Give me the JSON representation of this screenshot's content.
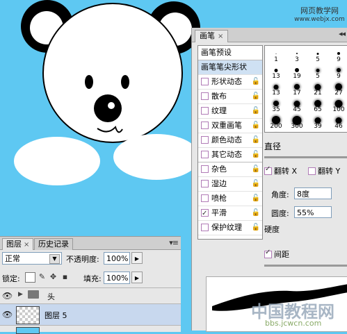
{
  "watermark_top": {
    "line1": "网页教学网",
    "line2": "www.webjx.com"
  },
  "watermark_bottom": {
    "line1": "中国教程网",
    "line2": "bbs.jcwcn.com"
  },
  "brush_panel": {
    "tab_label": "画笔",
    "tab_close": "×",
    "preset_label": "画笔预设",
    "items": [
      {
        "label": "画笔笔尖形状",
        "checked": false,
        "selected": true,
        "lock": false
      },
      {
        "label": "形状动态",
        "checked": false,
        "selected": false,
        "lock": true
      },
      {
        "label": "散布",
        "checked": false,
        "selected": false,
        "lock": true
      },
      {
        "label": "纹理",
        "checked": false,
        "selected": false,
        "lock": true
      },
      {
        "label": "双重画笔",
        "checked": false,
        "selected": false,
        "lock": true
      },
      {
        "label": "颜色动态",
        "checked": false,
        "selected": false,
        "lock": true
      },
      {
        "label": "其它动态",
        "checked": false,
        "selected": false,
        "lock": true
      },
      {
        "label": "杂色",
        "checked": false,
        "selected": false,
        "lock": true
      },
      {
        "label": "湿边",
        "checked": false,
        "selected": false,
        "lock": true
      },
      {
        "label": "喷枪",
        "checked": false,
        "selected": false,
        "lock": true
      },
      {
        "label": "平滑",
        "checked": true,
        "selected": false,
        "lock": true
      },
      {
        "label": "保护纹理",
        "checked": false,
        "selected": false,
        "lock": true
      }
    ],
    "brush_sizes": [
      "1",
      "3",
      "5",
      "9",
      "13",
      "19",
      "5",
      "9",
      "13",
      "17",
      "21",
      "27",
      "35",
      "45",
      "65",
      "100",
      "200",
      "300",
      "39",
      "46",
      "59",
      "11"
    ],
    "diameter_label": "直径",
    "flip_x_label": "翻转 X",
    "flip_y_label": "翻转 Y",
    "angle_label": "角度:",
    "angle_value": "8度",
    "roundness_label": "圆度:",
    "roundness_value": "55%",
    "hardness_label": "硬度",
    "spacing_label": "间距"
  },
  "layers_panel": {
    "tab_layers": "图层",
    "tab_history": "历史记录",
    "tab_close": "×",
    "blend_mode": "正常",
    "opacity_label": "不透明度:",
    "opacity_value": "100%",
    "lock_label": "锁定:",
    "fill_label": "填充:",
    "fill_value": "100%",
    "layers": [
      {
        "name": "头",
        "type": "group"
      },
      {
        "name": "图层 5",
        "type": "layer"
      }
    ]
  },
  "colors": {
    "canvas_bg": "#5ec8f2",
    "panel_bg": "#e7e7e7",
    "selection": "#cfe1f3"
  }
}
